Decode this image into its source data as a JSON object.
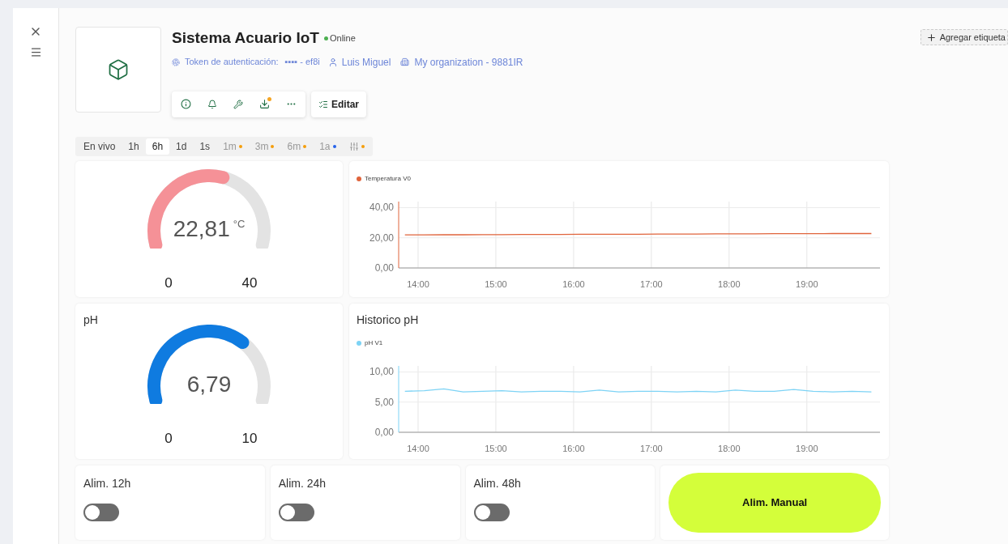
{
  "device": {
    "title": "Sistema Acuario IoT",
    "online": true,
    "status": "Online",
    "token_label": "Token de autenticación:",
    "token_value": "▪▪▪▪ - ef8i",
    "owner": "Luis Miguel",
    "organization": "My organization - 9881IR"
  },
  "add_tag_button": "Agregar etiqueta",
  "toolbar": {
    "download_badge": true,
    "edit_button": "Editar"
  },
  "time_ranges": [
    {
      "kind": "text",
      "label": "En vivo",
      "selected": false
    },
    {
      "kind": "text",
      "label": "1h",
      "selected": false
    },
    {
      "kind": "text",
      "label": "6h",
      "selected": true
    },
    {
      "kind": "text",
      "label": "1d",
      "selected": false
    },
    {
      "kind": "text",
      "label": "1s",
      "selected": false
    },
    {
      "kind": "text",
      "label": "1m",
      "selected": false,
      "color": "#f59e0b"
    },
    {
      "kind": "text",
      "label": "3m",
      "selected": false,
      "color": "#f59e0b"
    },
    {
      "kind": "text",
      "label": "6m",
      "selected": false,
      "color": "#f59e0b"
    },
    {
      "kind": "text",
      "label": "1a",
      "selected": false,
      "color": "#2563eb"
    },
    {
      "kind": "icon",
      "selected": false,
      "color": "#f59e0b"
    }
  ],
  "rows": [
    {
      "gauge": {
        "value": "22,81",
        "unit": "°C",
        "min": "0",
        "max": "40",
        "color": "#f59197"
      },
      "chart": {
        "chart_data": {
          "type": "line",
          "grid": true,
          "x": [
            13.83,
            14.08,
            14.33,
            14.58,
            14.83,
            15.08,
            15.33,
            15.58,
            15.83,
            16.08,
            16.33,
            16.58,
            16.83,
            17.08,
            17.33,
            17.58,
            17.83,
            18.08,
            18.33,
            18.58,
            18.83,
            19.08,
            19.33,
            19.58,
            19.83
          ],
          "xlim": [
            13.75,
            19.94
          ],
          "ylim": [
            0,
            44
          ],
          "xticks": [
            {
              "value": 14,
              "label": "14:00"
            },
            {
              "value": 15,
              "label": "15:00"
            },
            {
              "value": 16,
              "label": "16:00"
            },
            {
              "value": 17,
              "label": "17:00"
            },
            {
              "value": 18,
              "label": "18:00"
            },
            {
              "value": 19,
              "label": "19:00"
            }
          ],
          "yticks": [
            {
              "value": 0,
              "label": "0,00"
            },
            {
              "value": 20,
              "label": "20,00"
            },
            {
              "value": 40,
              "label": "40,00"
            }
          ],
          "series": [
            {
              "name": "Temperatura V0",
              "color": "#e0643c",
              "values": [
                21.9,
                21.9,
                22.0,
                22.0,
                22.1,
                22.1,
                22.2,
                22.2,
                22.2,
                22.3,
                22.3,
                22.4,
                22.4,
                22.5,
                22.5,
                22.5,
                22.6,
                22.6,
                22.6,
                22.7,
                22.7,
                22.7,
                22.8,
                22.8,
                22.8
              ]
            }
          ]
        }
      }
    },
    {
      "gauge": {
        "title": "pH",
        "value": "6,79",
        "min": "0",
        "max": "10",
        "color": "#0f7be0"
      },
      "chart": {
        "title": "Historico pH",
        "chart_data": {
          "type": "line",
          "grid": true,
          "x": [
            13.83,
            14.08,
            14.33,
            14.58,
            14.83,
            15.08,
            15.33,
            15.58,
            15.83,
            16.08,
            16.33,
            16.58,
            16.83,
            17.08,
            17.33,
            17.58,
            17.83,
            18.08,
            18.33,
            18.58,
            18.83,
            19.08,
            19.33,
            19.58,
            19.83
          ],
          "xlim": [
            13.75,
            19.94
          ],
          "ylim": [
            0,
            11
          ],
          "xticks": [
            {
              "value": 14,
              "label": "14:00"
            },
            {
              "value": 15,
              "label": "15:00"
            },
            {
              "value": 16,
              "label": "16:00"
            },
            {
              "value": 17,
              "label": "17:00"
            },
            {
              "value": 18,
              "label": "18:00"
            },
            {
              "value": 19,
              "label": "19:00"
            }
          ],
          "yticks": [
            {
              "value": 0,
              "label": "0,00"
            },
            {
              "value": 5,
              "label": "5,00"
            },
            {
              "value": 10,
              "label": "10,00"
            }
          ],
          "series": [
            {
              "name": "pH V1",
              "color": "#7dd3f5",
              "values": [
                6.8,
                6.9,
                7.2,
                6.7,
                6.8,
                6.9,
                6.7,
                6.8,
                6.8,
                6.7,
                7.0,
                6.7,
                6.8,
                6.8,
                6.7,
                6.8,
                6.7,
                7.0,
                6.8,
                6.8,
                7.1,
                6.8,
                6.7,
                6.8,
                6.7
              ]
            }
          ]
        }
      }
    }
  ],
  "switches": [
    {
      "label": "Alim. 12h",
      "on": false
    },
    {
      "label": "Alim. 24h",
      "on": false
    },
    {
      "label": "Alim. 48h",
      "on": false
    }
  ],
  "manual_button": "Alim. Manual"
}
